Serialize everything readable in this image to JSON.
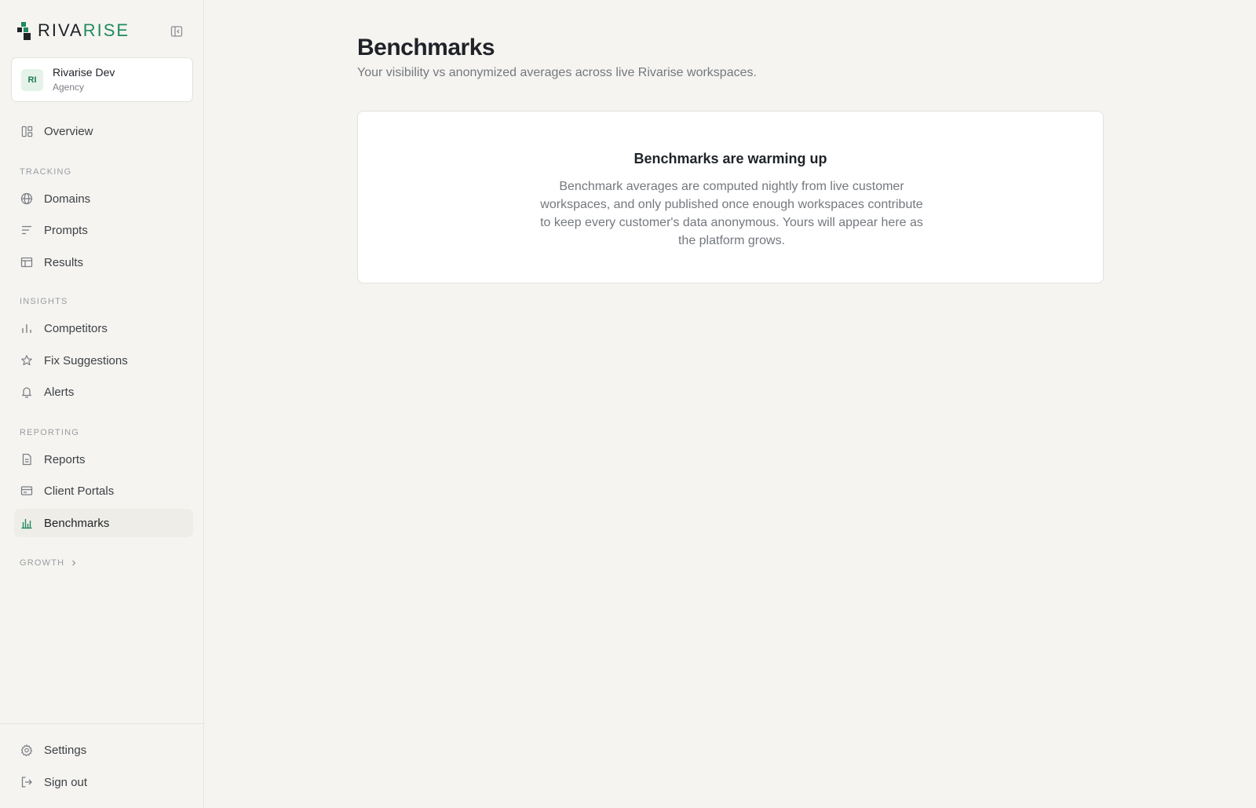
{
  "brand": {
    "name_a": "RIVA",
    "name_b": "RISE",
    "accent": "#1f8a5e"
  },
  "workspace": {
    "initials": "RI",
    "name": "Rivarise Dev",
    "type": "Agency"
  },
  "nav": {
    "overview": "Overview",
    "tracking_label": "TRACKING",
    "domains": "Domains",
    "prompts": "Prompts",
    "results": "Results",
    "insights_label": "INSIGHTS",
    "competitors": "Competitors",
    "fix_suggestions": "Fix Suggestions",
    "alerts": "Alerts",
    "reporting_label": "REPORTING",
    "reports": "Reports",
    "client_portals": "Client Portals",
    "benchmarks": "Benchmarks",
    "growth_label": "GROWTH",
    "settings": "Settings",
    "sign_out": "Sign out"
  },
  "page": {
    "title": "Benchmarks",
    "subtitle": "Your visibility vs anonymized averages across live Rivarise workspaces."
  },
  "empty_state": {
    "title": "Benchmarks are warming up",
    "body": "Benchmark averages are computed nightly from live customer workspaces, and only published once enough workspaces contribute to keep every customer's data anonymous. Yours will appear here as the platform grows."
  }
}
